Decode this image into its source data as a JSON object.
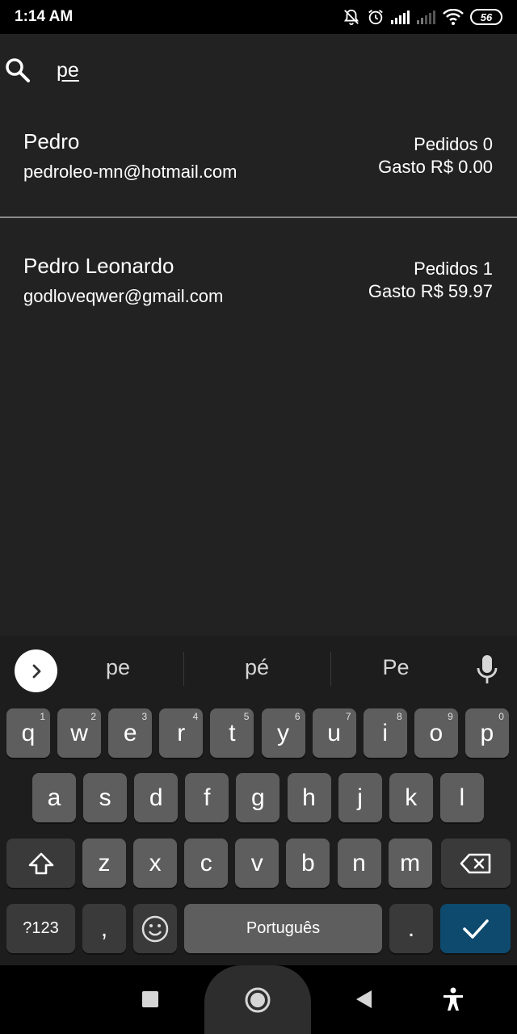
{
  "status_bar": {
    "time": "1:14 AM",
    "battery": "56",
    "icons": [
      "mute-icon",
      "alarm-icon",
      "signal-icon",
      "signal-weak-icon",
      "wifi-icon",
      "battery-icon"
    ]
  },
  "search": {
    "icon": "search-icon",
    "value": "pe"
  },
  "customers": [
    {
      "name": "Pedro",
      "email": "pedroleo-mn@hotmail.com",
      "orders": "Pedidos 0",
      "spent": "Gasto R$ 0.00"
    },
    {
      "name": "Pedro Leonardo",
      "email": "godloveqwer@gmail.com",
      "orders": "Pedidos 1",
      "spent": "Gasto R$ 59.97"
    }
  ],
  "keyboard": {
    "suggestions": [
      "pe",
      "pé",
      "Pe"
    ],
    "row1": [
      {
        "k": "q",
        "h": "1"
      },
      {
        "k": "w",
        "h": "2"
      },
      {
        "k": "e",
        "h": "3"
      },
      {
        "k": "r",
        "h": "4"
      },
      {
        "k": "t",
        "h": "5"
      },
      {
        "k": "y",
        "h": "6"
      },
      {
        "k": "u",
        "h": "7"
      },
      {
        "k": "i",
        "h": "8"
      },
      {
        "k": "o",
        "h": "9"
      },
      {
        "k": "p",
        "h": "0"
      }
    ],
    "row2": [
      "a",
      "s",
      "d",
      "f",
      "g",
      "h",
      "j",
      "k",
      "l"
    ],
    "row3": [
      "z",
      "x",
      "c",
      "v",
      "b",
      "n",
      "m"
    ],
    "symbols_label": "?123",
    "comma_label": ",",
    "space_label": "Português",
    "period_label": "."
  },
  "colors": {
    "background": "#222222",
    "keyboard_bg": "#1d1d1d",
    "key": "#5e5e5e",
    "key_dark": "#3a3a3a",
    "enter_key": "#0d4a6e",
    "divider": "#8a8a8a"
  }
}
